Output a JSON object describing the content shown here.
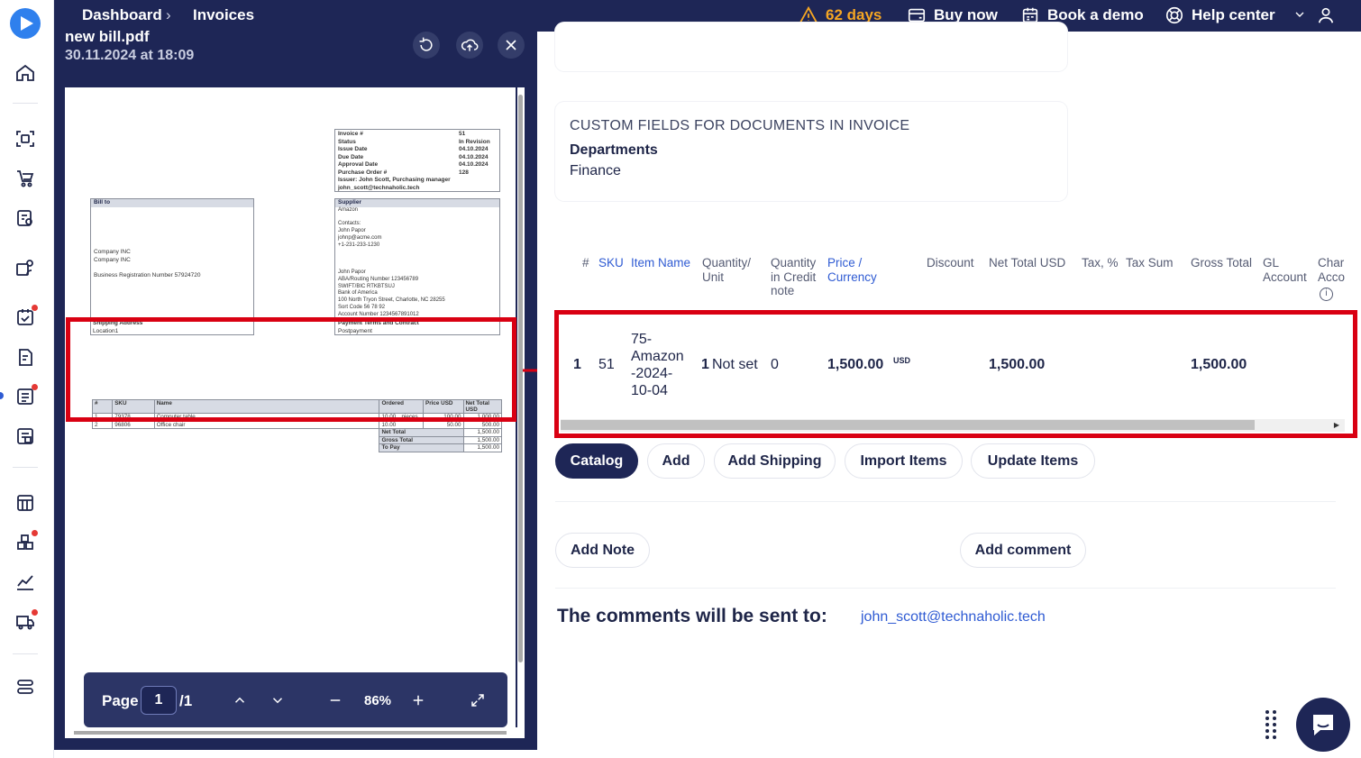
{
  "topbar": {
    "breadcrumb": [
      "Dashboard",
      "Invoices"
    ],
    "trial": "62 days",
    "buy_now": "Buy now",
    "book_demo": "Book a demo",
    "help_center": "Help center"
  },
  "preview": {
    "file_name": "new bill.pdf",
    "file_date": "30.11.2024 at 18:09",
    "pager": {
      "label": "Page",
      "current": "1",
      "total": "/1",
      "zoom": "86%"
    },
    "document": {
      "invoice_box": [
        [
          "Invoice #",
          "51"
        ],
        [
          "Status",
          "In Revision"
        ],
        [
          "Issue Date",
          "04.10.2024"
        ],
        [
          "Due Date",
          "04.10.2024"
        ],
        [
          "Approval Date",
          "04.10.2024"
        ],
        [
          "Purchase Order #",
          "128"
        ]
      ],
      "issuer": "Issuer: John Scott, Purchasing manager",
      "issuer_email": "john_scott@technaholic.tech",
      "bill_to_header": "Bill to",
      "bill_to_lines": [
        "Company INC",
        "Company INC",
        "",
        "Business Registration Number 57924720"
      ],
      "supplier_header": "Supplier",
      "supplier_lines": [
        "Amazon",
        "",
        "Contacts:",
        "John Papor",
        "johnp@acme.com",
        "+1-231-233-1230",
        "",
        "",
        "",
        "John Papor",
        "ABA/Routing Number 123456789",
        "SWIFT/BIC RTKBTSUJ",
        "Bank of America",
        "100 North Tryon Street, Charlotte, NC 28255",
        "Sort Code 56 78 92",
        "Account Number 1234567891012"
      ],
      "shipping_header": "Shipping Address",
      "shipping_value": "Location1",
      "payment_header": "Payment Terms and Contract",
      "payment_value": "Postpayment",
      "items_headers": [
        "#",
        "SKU",
        "Name",
        "Ordered",
        "Price USD",
        "Net Total USD"
      ],
      "items": [
        [
          "1",
          "79378",
          "Computer table",
          "10.00",
          "pieces",
          "100.00",
          "1,000.00"
        ],
        [
          "2",
          "96806",
          "Office chair",
          "10.00",
          "",
          "50.00",
          "500.00"
        ]
      ],
      "totals": [
        [
          "Net Total",
          "1,500.00"
        ],
        [
          "Gross Total",
          "1,500.00"
        ],
        [
          "To Pay",
          "1,500.00"
        ]
      ]
    }
  },
  "custom_fields": {
    "title": "CUSTOM FIELDS FOR DOCUMENTS IN INVOICE",
    "label": "Departments",
    "value": "Finance"
  },
  "items_table": {
    "headers": [
      "#",
      "SKU",
      "Item Name",
      "Quantity/ Unit",
      "Quantity in Credit note",
      "Price / Currency",
      "Discount",
      "Net Total USD",
      "Tax, %",
      "Tax Sum",
      "Gross Total",
      "GL Account",
      "Char Acco"
    ],
    "row": {
      "index": "1",
      "sku": "51",
      "item_name": "75- Amazon -2024- 10-04",
      "quantity": "1",
      "unit": "Not set",
      "credit_qty": "0",
      "price": "1,500.00",
      "currency": "USD",
      "net_total": "1,500.00",
      "gross_total": "1,500.00"
    }
  },
  "actions": [
    "Catalog",
    "Add",
    "Add Shipping",
    "Import Items",
    "Update Items"
  ],
  "notes": {
    "add_note": "Add Note",
    "add_comment": "Add comment"
  },
  "comments": {
    "label": "The comments will be sent to:",
    "email": "john_scott@technaholic.tech"
  },
  "colors": {
    "navy": "#1e2656",
    "accent": "#2f5bd3",
    "highlight": "#d90012",
    "warning": "#f5a623"
  }
}
